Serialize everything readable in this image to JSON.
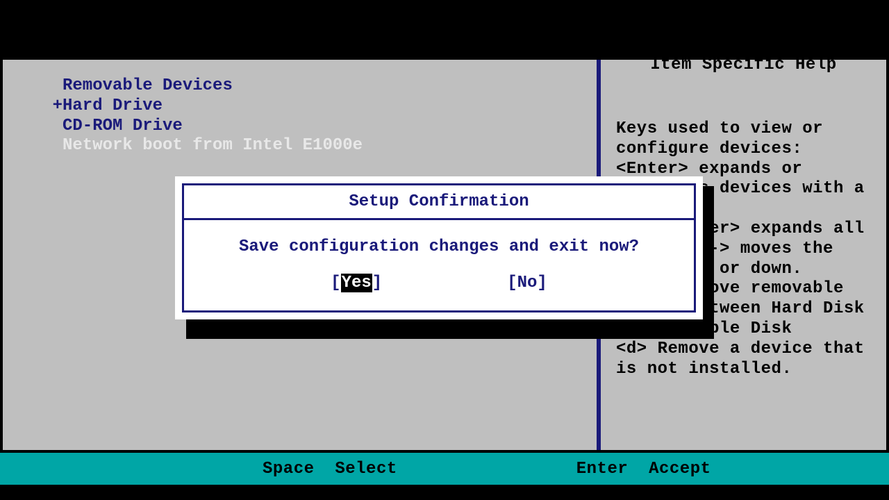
{
  "boot": {
    "items": [
      {
        "prefix": " ",
        "label": "Removable Devices",
        "selected": false
      },
      {
        "prefix": "+",
        "label": "Hard Drive",
        "selected": false
      },
      {
        "prefix": " ",
        "label": "CD-ROM Drive",
        "selected": false
      },
      {
        "prefix": " ",
        "label": "Network boot from Intel E1000e",
        "selected": true
      }
    ]
  },
  "help": {
    "title": "Item Specific Help",
    "body": "Keys used to view or configure devices:\n<Enter> expands or collapses devices with a + or -\n<Ctrl+Enter> expands all\n<+> and <-> moves the device up or down.\n<n> May move removable device between Hard Disk or Removable Disk\n<d> Remove a device that is not installed."
  },
  "dialog": {
    "title": "Setup Confirmation",
    "message": "Save configuration changes and exit now?",
    "yes": "Yes",
    "no": "No",
    "selected": "yes"
  },
  "footer": {
    "k1": "Space",
    "a1": "Select",
    "k2": "Enter",
    "a2": "Accept"
  }
}
